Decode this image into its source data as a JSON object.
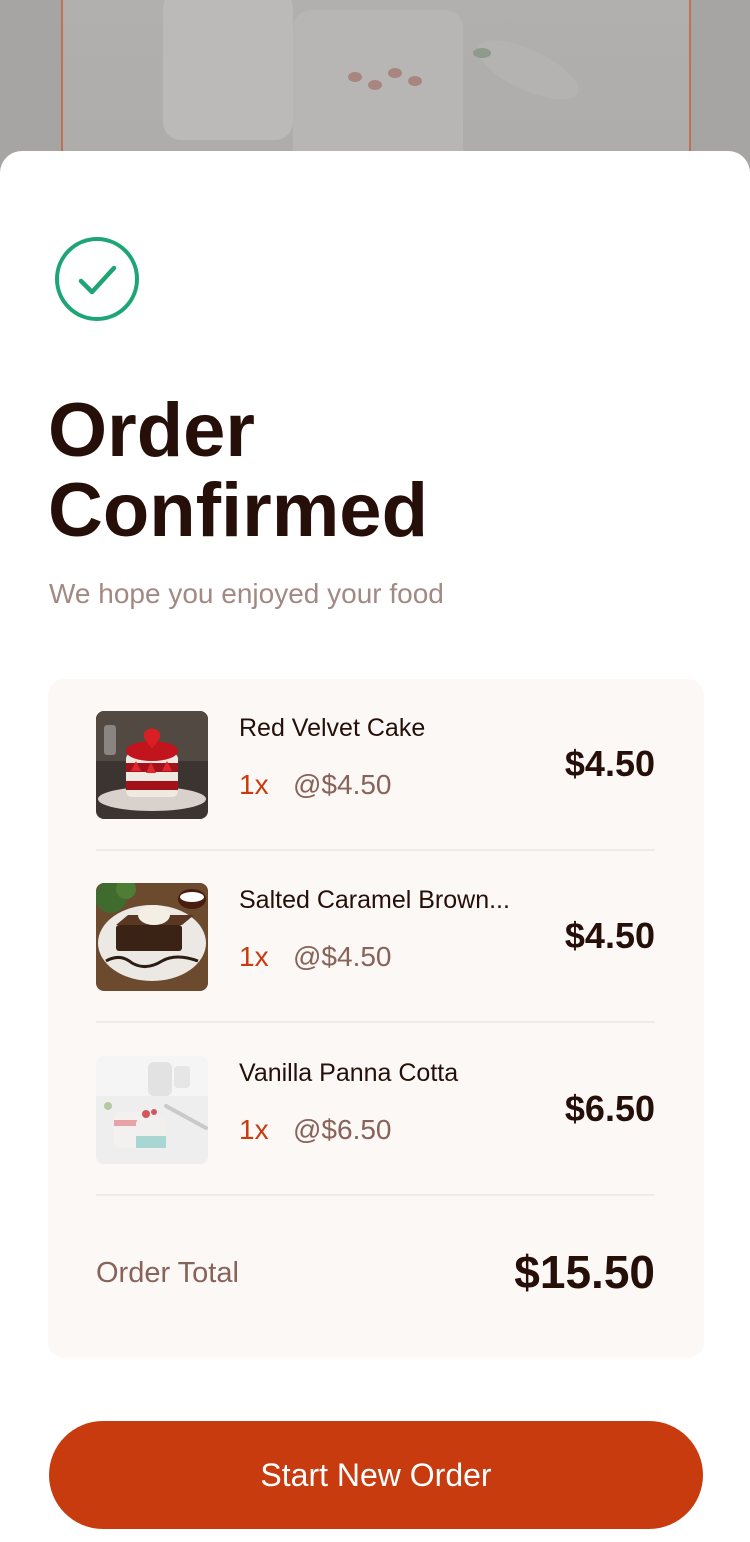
{
  "modal": {
    "title": "Order Confirmed",
    "subtitle": "We hope you enjoyed your food",
    "check_icon": "check-circle-icon",
    "accent_color": "#1ea575",
    "button_color": "#c73b0f"
  },
  "order": {
    "items": [
      {
        "name": "Red Velvet Cake",
        "quantity": "1x",
        "unit_price": "@$4.50",
        "total": "$4.50"
      },
      {
        "name": "Salted Caramel Brown...",
        "quantity": "1x",
        "unit_price": "@$4.50",
        "total": "$4.50"
      },
      {
        "name": "Vanilla Panna Cotta",
        "quantity": "1x",
        "unit_price": "@$6.50",
        "total": "$6.50"
      }
    ],
    "total_label": "Order Total",
    "total_value": "$15.50"
  },
  "actions": {
    "start_new_order_label": "Start New Order"
  }
}
